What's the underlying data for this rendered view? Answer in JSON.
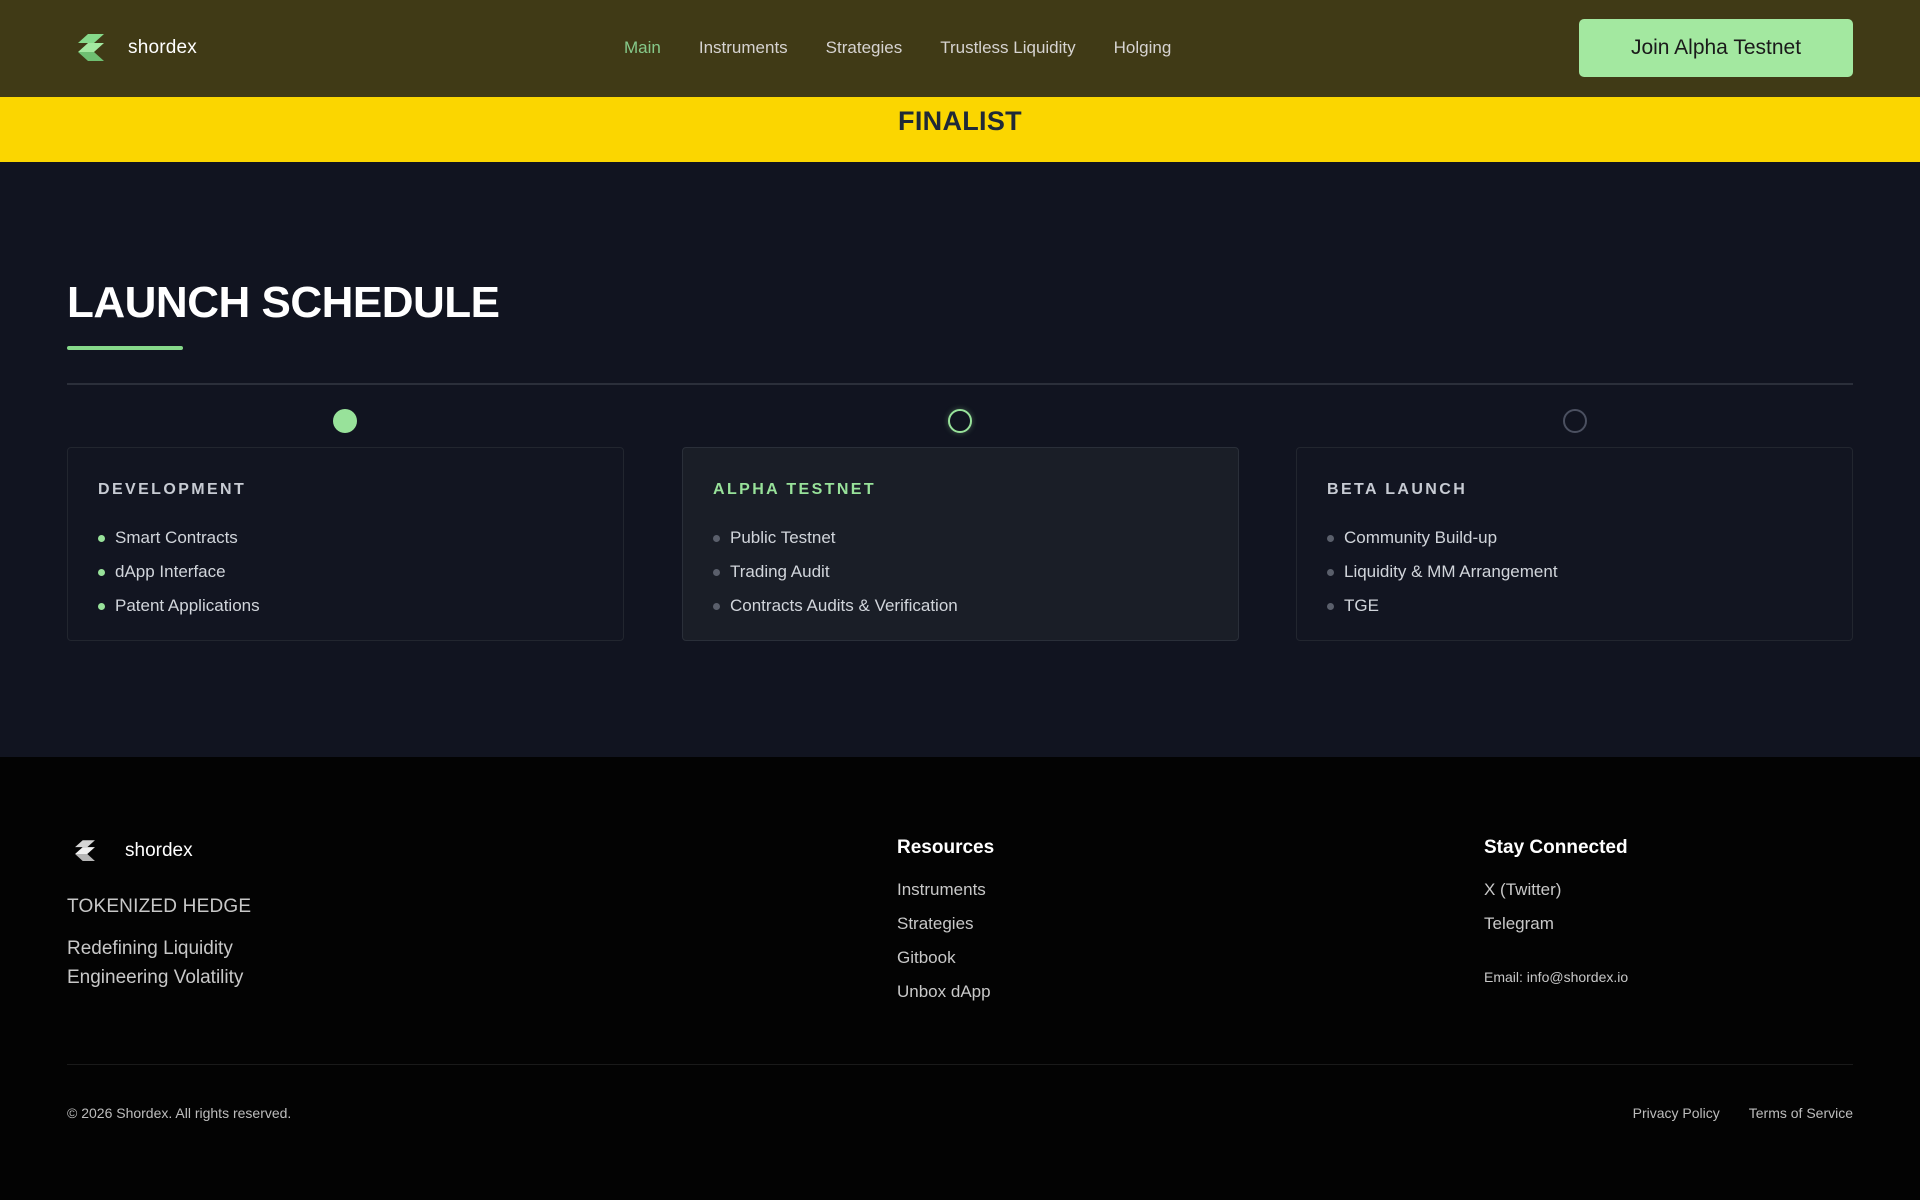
{
  "header": {
    "brand": "shordex",
    "nav": [
      {
        "label": "Main",
        "active": true
      },
      {
        "label": "Instruments",
        "active": false
      },
      {
        "label": "Strategies",
        "active": false
      },
      {
        "label": "Trustless Liquidity",
        "active": false
      },
      {
        "label": "Holging",
        "active": false
      }
    ],
    "cta_label": "Join Alpha Testnet"
  },
  "banner": {
    "text": "FINALIST"
  },
  "schedule": {
    "title": "LAUNCH SCHEDULE",
    "phases": [
      {
        "title": "DEVELOPMENT",
        "status": "completed",
        "items": [
          "Smart Contracts",
          "dApp Interface",
          "Patent Applications"
        ]
      },
      {
        "title": "ALPHA TESTNET",
        "status": "current",
        "items": [
          "Public Testnet",
          "Trading Audit",
          "Contracts Audits & Verification"
        ]
      },
      {
        "title": "BETA LAUNCH",
        "status": "upcoming",
        "items": [
          "Community Build-up",
          "Liquidity & MM Arrangement",
          "TGE"
        ]
      }
    ]
  },
  "footer": {
    "brand": "shordex",
    "tagline": "TOKENIZED HEDGE",
    "motto_line1": "Redefining Liquidity",
    "motto_line2": "Engineering Volatility",
    "resources": {
      "title": "Resources",
      "links": [
        "Instruments",
        "Strategies",
        "Gitbook",
        "Unbox dApp"
      ]
    },
    "connect": {
      "title": "Stay Connected",
      "links": [
        "X (Twitter)",
        "Telegram"
      ],
      "email": "Email: info@shordex.io"
    },
    "copyright": "© 2026 Shordex. All rights reserved.",
    "legal": [
      "Privacy Policy",
      "Terms of Service"
    ]
  },
  "colors": {
    "accent_green": "#98e29a",
    "header_bg": "#403a16",
    "banner_yellow": "#fbd600",
    "section_bg": "#111420",
    "footer_bg": "#030303"
  },
  "icons": {
    "logo": "shordex-logo-icon",
    "timeline_completed": "filled-circle",
    "timeline_current": "ring-circle",
    "timeline_upcoming": "empty-circle"
  }
}
